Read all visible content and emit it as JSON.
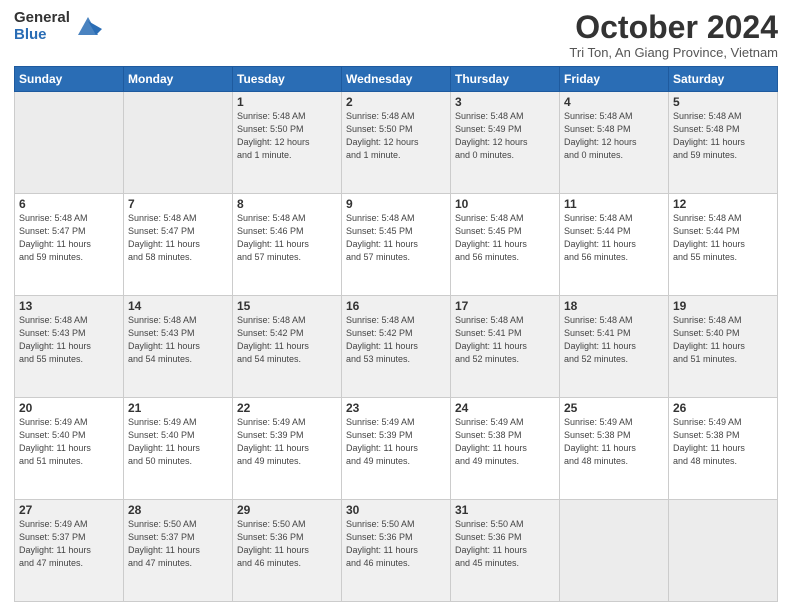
{
  "header": {
    "logo_general": "General",
    "logo_blue": "Blue",
    "month_title": "October 2024",
    "location": "Tri Ton, An Giang Province, Vietnam"
  },
  "days_of_week": [
    "Sunday",
    "Monday",
    "Tuesday",
    "Wednesday",
    "Thursday",
    "Friday",
    "Saturday"
  ],
  "weeks": [
    [
      {
        "day": "",
        "info": ""
      },
      {
        "day": "",
        "info": ""
      },
      {
        "day": "1",
        "info": "Sunrise: 5:48 AM\nSunset: 5:50 PM\nDaylight: 12 hours\nand 1 minute."
      },
      {
        "day": "2",
        "info": "Sunrise: 5:48 AM\nSunset: 5:50 PM\nDaylight: 12 hours\nand 1 minute."
      },
      {
        "day": "3",
        "info": "Sunrise: 5:48 AM\nSunset: 5:49 PM\nDaylight: 12 hours\nand 0 minutes."
      },
      {
        "day": "4",
        "info": "Sunrise: 5:48 AM\nSunset: 5:48 PM\nDaylight: 12 hours\nand 0 minutes."
      },
      {
        "day": "5",
        "info": "Sunrise: 5:48 AM\nSunset: 5:48 PM\nDaylight: 11 hours\nand 59 minutes."
      }
    ],
    [
      {
        "day": "6",
        "info": "Sunrise: 5:48 AM\nSunset: 5:47 PM\nDaylight: 11 hours\nand 59 minutes."
      },
      {
        "day": "7",
        "info": "Sunrise: 5:48 AM\nSunset: 5:47 PM\nDaylight: 11 hours\nand 58 minutes."
      },
      {
        "day": "8",
        "info": "Sunrise: 5:48 AM\nSunset: 5:46 PM\nDaylight: 11 hours\nand 57 minutes."
      },
      {
        "day": "9",
        "info": "Sunrise: 5:48 AM\nSunset: 5:45 PM\nDaylight: 11 hours\nand 57 minutes."
      },
      {
        "day": "10",
        "info": "Sunrise: 5:48 AM\nSunset: 5:45 PM\nDaylight: 11 hours\nand 56 minutes."
      },
      {
        "day": "11",
        "info": "Sunrise: 5:48 AM\nSunset: 5:44 PM\nDaylight: 11 hours\nand 56 minutes."
      },
      {
        "day": "12",
        "info": "Sunrise: 5:48 AM\nSunset: 5:44 PM\nDaylight: 11 hours\nand 55 minutes."
      }
    ],
    [
      {
        "day": "13",
        "info": "Sunrise: 5:48 AM\nSunset: 5:43 PM\nDaylight: 11 hours\nand 55 minutes."
      },
      {
        "day": "14",
        "info": "Sunrise: 5:48 AM\nSunset: 5:43 PM\nDaylight: 11 hours\nand 54 minutes."
      },
      {
        "day": "15",
        "info": "Sunrise: 5:48 AM\nSunset: 5:42 PM\nDaylight: 11 hours\nand 54 minutes."
      },
      {
        "day": "16",
        "info": "Sunrise: 5:48 AM\nSunset: 5:42 PM\nDaylight: 11 hours\nand 53 minutes."
      },
      {
        "day": "17",
        "info": "Sunrise: 5:48 AM\nSunset: 5:41 PM\nDaylight: 11 hours\nand 52 minutes."
      },
      {
        "day": "18",
        "info": "Sunrise: 5:48 AM\nSunset: 5:41 PM\nDaylight: 11 hours\nand 52 minutes."
      },
      {
        "day": "19",
        "info": "Sunrise: 5:48 AM\nSunset: 5:40 PM\nDaylight: 11 hours\nand 51 minutes."
      }
    ],
    [
      {
        "day": "20",
        "info": "Sunrise: 5:49 AM\nSunset: 5:40 PM\nDaylight: 11 hours\nand 51 minutes."
      },
      {
        "day": "21",
        "info": "Sunrise: 5:49 AM\nSunset: 5:40 PM\nDaylight: 11 hours\nand 50 minutes."
      },
      {
        "day": "22",
        "info": "Sunrise: 5:49 AM\nSunset: 5:39 PM\nDaylight: 11 hours\nand 49 minutes."
      },
      {
        "day": "23",
        "info": "Sunrise: 5:49 AM\nSunset: 5:39 PM\nDaylight: 11 hours\nand 49 minutes."
      },
      {
        "day": "24",
        "info": "Sunrise: 5:49 AM\nSunset: 5:38 PM\nDaylight: 11 hours\nand 49 minutes."
      },
      {
        "day": "25",
        "info": "Sunrise: 5:49 AM\nSunset: 5:38 PM\nDaylight: 11 hours\nand 48 minutes."
      },
      {
        "day": "26",
        "info": "Sunrise: 5:49 AM\nSunset: 5:38 PM\nDaylight: 11 hours\nand 48 minutes."
      }
    ],
    [
      {
        "day": "27",
        "info": "Sunrise: 5:49 AM\nSunset: 5:37 PM\nDaylight: 11 hours\nand 47 minutes."
      },
      {
        "day": "28",
        "info": "Sunrise: 5:50 AM\nSunset: 5:37 PM\nDaylight: 11 hours\nand 47 minutes."
      },
      {
        "day": "29",
        "info": "Sunrise: 5:50 AM\nSunset: 5:36 PM\nDaylight: 11 hours\nand 46 minutes."
      },
      {
        "day": "30",
        "info": "Sunrise: 5:50 AM\nSunset: 5:36 PM\nDaylight: 11 hours\nand 46 minutes."
      },
      {
        "day": "31",
        "info": "Sunrise: 5:50 AM\nSunset: 5:36 PM\nDaylight: 11 hours\nand 45 minutes."
      },
      {
        "day": "",
        "info": ""
      },
      {
        "day": "",
        "info": ""
      }
    ]
  ]
}
